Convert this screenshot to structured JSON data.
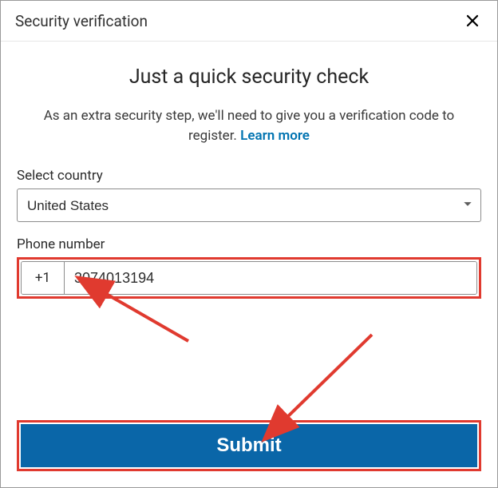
{
  "header": {
    "title": "Security verification"
  },
  "main": {
    "heading": "Just a quick security check",
    "subtext_prefix": "As an extra security step, we'll need to give you a verification code to register. ",
    "learn_more": "Learn more"
  },
  "form": {
    "country_label": "Select country",
    "country_value": "United States",
    "phone_label": "Phone number",
    "phone_prefix": "+1",
    "phone_value": "3074013194",
    "submit_label": "Submit"
  },
  "colors": {
    "accent": "#0a66a8",
    "highlight": "#e03a2f",
    "link": "#0073b1"
  }
}
